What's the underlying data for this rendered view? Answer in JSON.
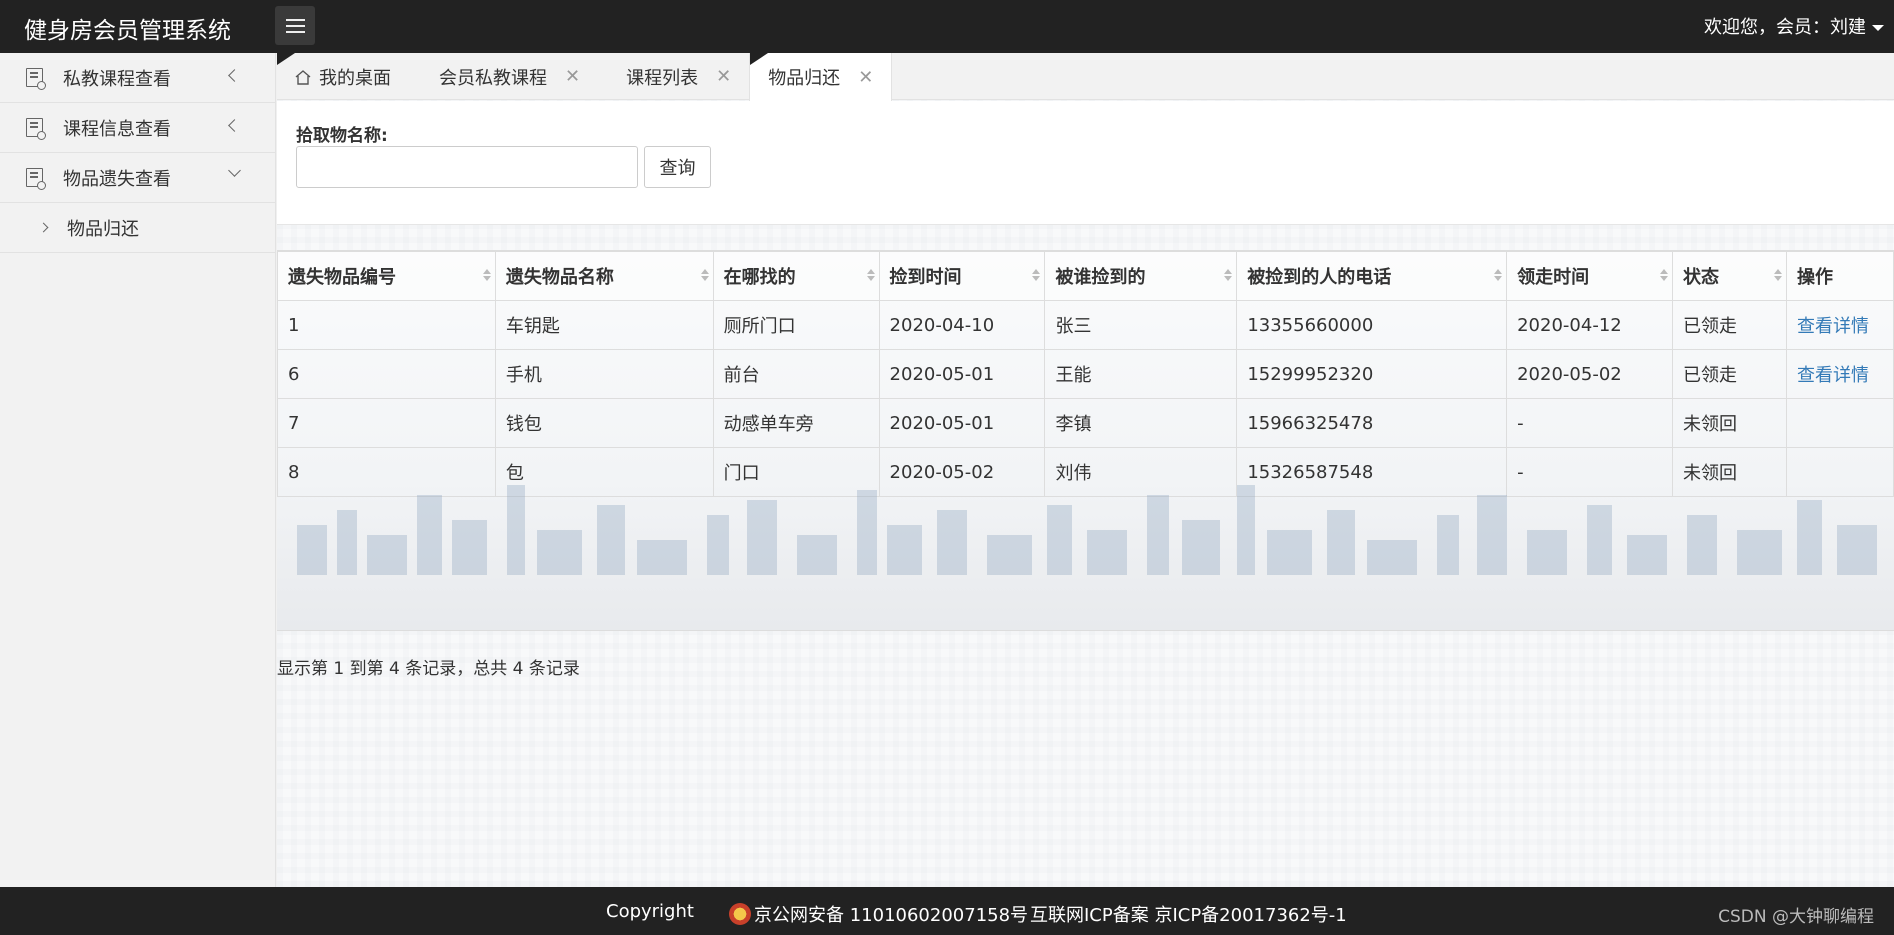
{
  "app": {
    "title": "健身房会员管理系统",
    "welcome": "欢迎您，会员：刘建"
  },
  "sidebar": {
    "items": [
      {
        "label": "私教课程查看"
      },
      {
        "label": "课程信息查看"
      },
      {
        "label": "物品遗失查看"
      }
    ],
    "sub_items": [
      {
        "label": "物品归还"
      }
    ]
  },
  "tabs": [
    {
      "label": "我的桌面"
    },
    {
      "label": "会员私教课程"
    },
    {
      "label": "课程列表"
    },
    {
      "label": "物品归还"
    }
  ],
  "search": {
    "label": "拾取物名称:",
    "value": "",
    "button": "查询"
  },
  "table": {
    "headers": [
      "遗失物品编号",
      "遗失物品名称",
      "在哪找的",
      "捡到时间",
      "被谁捡到的",
      "被捡到的人的电话",
      "领走时间",
      "状态",
      "操作"
    ],
    "rows": [
      [
        "1",
        "车钥匙",
        "厕所门口",
        "2020-04-10",
        "张三",
        "13355660000",
        "2020-04-12",
        "已领走",
        "查看详情"
      ],
      [
        "6",
        "手机",
        "前台",
        "2020-05-01",
        "王能",
        "15299952320",
        "2020-05-02",
        "已领走",
        "查看详情"
      ],
      [
        "7",
        "钱包",
        "动感单车旁",
        "2020-05-01",
        "李镇",
        "15966325478",
        "-",
        "未领回",
        ""
      ],
      [
        "8",
        "包",
        "门口",
        "2020-05-02",
        "刘伟",
        "15326587548",
        "-",
        "未领回",
        ""
      ]
    ]
  },
  "pager": {
    "info": "显示第 1 到第 4 条记录，总共 4 条记录"
  },
  "footer": {
    "copyright": "Copyright",
    "police": "京公网安备 11010602007158号",
    "icp": "互联网ICP备案 京ICP备20017362号-1",
    "csdn": "CSDN @大钟聊编程"
  },
  "colors": {
    "topbar": "#222222",
    "link": "#337ab7",
    "sidebar": "#f2f2f2"
  }
}
